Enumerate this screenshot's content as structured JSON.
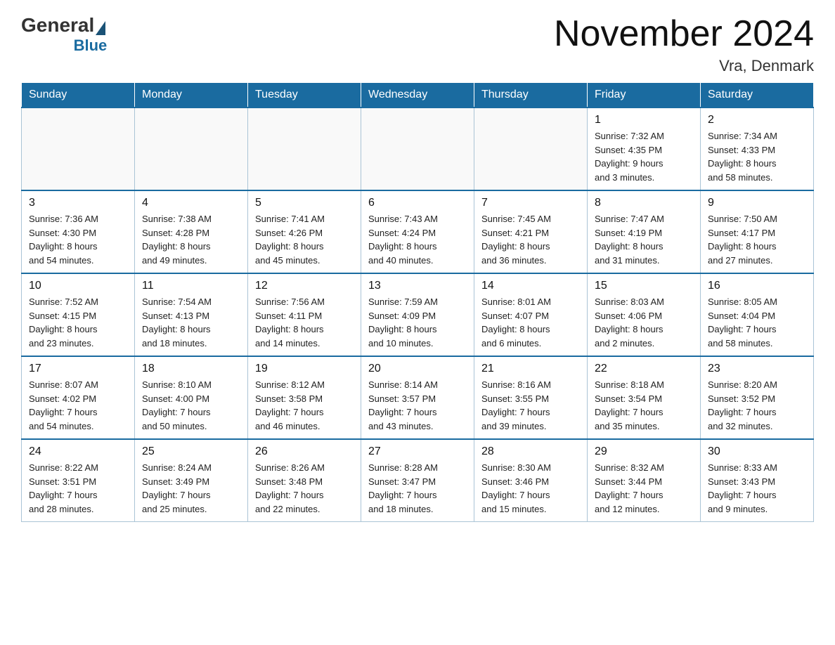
{
  "header": {
    "logo_general": "General",
    "logo_blue": "Blue",
    "month_title": "November 2024",
    "location": "Vra, Denmark"
  },
  "weekdays": [
    "Sunday",
    "Monday",
    "Tuesday",
    "Wednesday",
    "Thursday",
    "Friday",
    "Saturday"
  ],
  "weeks": [
    [
      {
        "day": "",
        "info": ""
      },
      {
        "day": "",
        "info": ""
      },
      {
        "day": "",
        "info": ""
      },
      {
        "day": "",
        "info": ""
      },
      {
        "day": "",
        "info": ""
      },
      {
        "day": "1",
        "info": "Sunrise: 7:32 AM\nSunset: 4:35 PM\nDaylight: 9 hours\nand 3 minutes."
      },
      {
        "day": "2",
        "info": "Sunrise: 7:34 AM\nSunset: 4:33 PM\nDaylight: 8 hours\nand 58 minutes."
      }
    ],
    [
      {
        "day": "3",
        "info": "Sunrise: 7:36 AM\nSunset: 4:30 PM\nDaylight: 8 hours\nand 54 minutes."
      },
      {
        "day": "4",
        "info": "Sunrise: 7:38 AM\nSunset: 4:28 PM\nDaylight: 8 hours\nand 49 minutes."
      },
      {
        "day": "5",
        "info": "Sunrise: 7:41 AM\nSunset: 4:26 PM\nDaylight: 8 hours\nand 45 minutes."
      },
      {
        "day": "6",
        "info": "Sunrise: 7:43 AM\nSunset: 4:24 PM\nDaylight: 8 hours\nand 40 minutes."
      },
      {
        "day": "7",
        "info": "Sunrise: 7:45 AM\nSunset: 4:21 PM\nDaylight: 8 hours\nand 36 minutes."
      },
      {
        "day": "8",
        "info": "Sunrise: 7:47 AM\nSunset: 4:19 PM\nDaylight: 8 hours\nand 31 minutes."
      },
      {
        "day": "9",
        "info": "Sunrise: 7:50 AM\nSunset: 4:17 PM\nDaylight: 8 hours\nand 27 minutes."
      }
    ],
    [
      {
        "day": "10",
        "info": "Sunrise: 7:52 AM\nSunset: 4:15 PM\nDaylight: 8 hours\nand 23 minutes."
      },
      {
        "day": "11",
        "info": "Sunrise: 7:54 AM\nSunset: 4:13 PM\nDaylight: 8 hours\nand 18 minutes."
      },
      {
        "day": "12",
        "info": "Sunrise: 7:56 AM\nSunset: 4:11 PM\nDaylight: 8 hours\nand 14 minutes."
      },
      {
        "day": "13",
        "info": "Sunrise: 7:59 AM\nSunset: 4:09 PM\nDaylight: 8 hours\nand 10 minutes."
      },
      {
        "day": "14",
        "info": "Sunrise: 8:01 AM\nSunset: 4:07 PM\nDaylight: 8 hours\nand 6 minutes."
      },
      {
        "day": "15",
        "info": "Sunrise: 8:03 AM\nSunset: 4:06 PM\nDaylight: 8 hours\nand 2 minutes."
      },
      {
        "day": "16",
        "info": "Sunrise: 8:05 AM\nSunset: 4:04 PM\nDaylight: 7 hours\nand 58 minutes."
      }
    ],
    [
      {
        "day": "17",
        "info": "Sunrise: 8:07 AM\nSunset: 4:02 PM\nDaylight: 7 hours\nand 54 minutes."
      },
      {
        "day": "18",
        "info": "Sunrise: 8:10 AM\nSunset: 4:00 PM\nDaylight: 7 hours\nand 50 minutes."
      },
      {
        "day": "19",
        "info": "Sunrise: 8:12 AM\nSunset: 3:58 PM\nDaylight: 7 hours\nand 46 minutes."
      },
      {
        "day": "20",
        "info": "Sunrise: 8:14 AM\nSunset: 3:57 PM\nDaylight: 7 hours\nand 43 minutes."
      },
      {
        "day": "21",
        "info": "Sunrise: 8:16 AM\nSunset: 3:55 PM\nDaylight: 7 hours\nand 39 minutes."
      },
      {
        "day": "22",
        "info": "Sunrise: 8:18 AM\nSunset: 3:54 PM\nDaylight: 7 hours\nand 35 minutes."
      },
      {
        "day": "23",
        "info": "Sunrise: 8:20 AM\nSunset: 3:52 PM\nDaylight: 7 hours\nand 32 minutes."
      }
    ],
    [
      {
        "day": "24",
        "info": "Sunrise: 8:22 AM\nSunset: 3:51 PM\nDaylight: 7 hours\nand 28 minutes."
      },
      {
        "day": "25",
        "info": "Sunrise: 8:24 AM\nSunset: 3:49 PM\nDaylight: 7 hours\nand 25 minutes."
      },
      {
        "day": "26",
        "info": "Sunrise: 8:26 AM\nSunset: 3:48 PM\nDaylight: 7 hours\nand 22 minutes."
      },
      {
        "day": "27",
        "info": "Sunrise: 8:28 AM\nSunset: 3:47 PM\nDaylight: 7 hours\nand 18 minutes."
      },
      {
        "day": "28",
        "info": "Sunrise: 8:30 AM\nSunset: 3:46 PM\nDaylight: 7 hours\nand 15 minutes."
      },
      {
        "day": "29",
        "info": "Sunrise: 8:32 AM\nSunset: 3:44 PM\nDaylight: 7 hours\nand 12 minutes."
      },
      {
        "day": "30",
        "info": "Sunrise: 8:33 AM\nSunset: 3:43 PM\nDaylight: 7 hours\nand 9 minutes."
      }
    ]
  ]
}
